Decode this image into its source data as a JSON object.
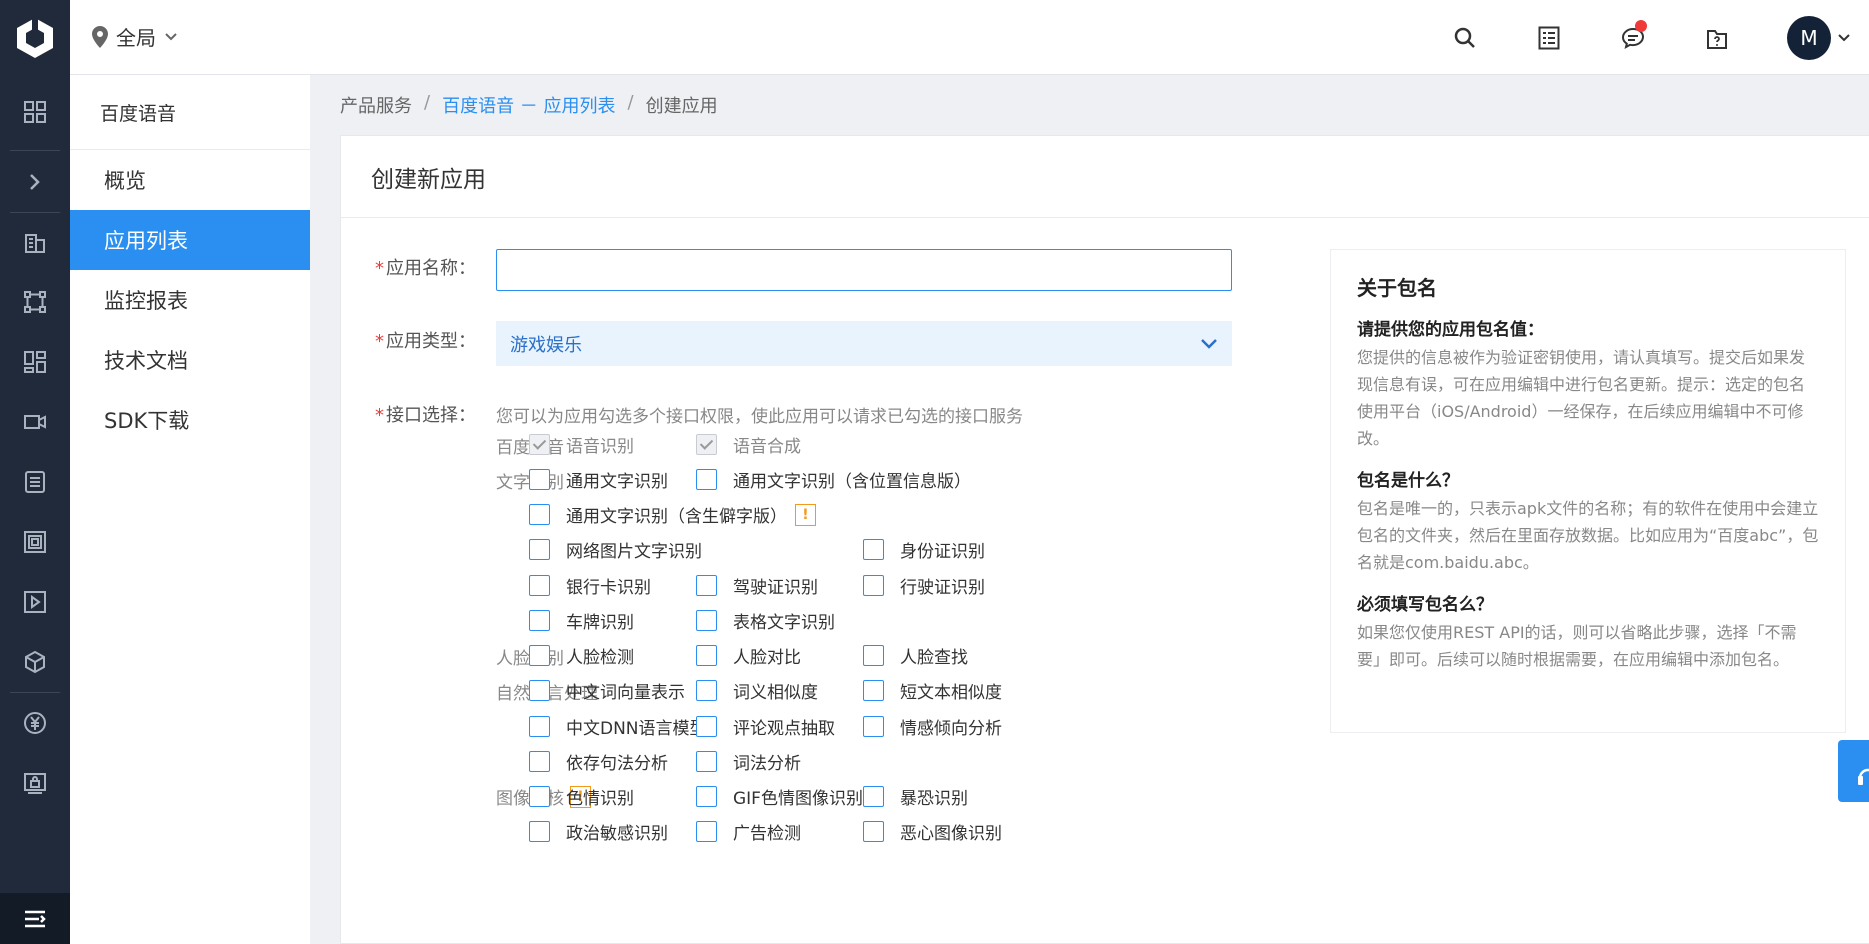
{
  "topbar": {
    "region": "全局",
    "avatar_letter": "M",
    "icons": [
      "search-icon",
      "list-icon",
      "message-icon",
      "help-icon"
    ]
  },
  "rail": {
    "icons": [
      "apps-icon",
      "chevron-right-icon",
      "building-icon",
      "network-icon",
      "dashboard-icon",
      "video-icon",
      "database-icon",
      "layers-icon",
      "play-icon",
      "cube-icon",
      "yuan-icon",
      "lock-icon",
      "menu-icon"
    ]
  },
  "subnav": {
    "title": "百度语音",
    "items": [
      {
        "label": "概览"
      },
      {
        "label": "应用列表"
      },
      {
        "label": "监控报表"
      },
      {
        "label": "技术文档"
      },
      {
        "label": "SDK下载"
      }
    ]
  },
  "breadcrumb": {
    "root": "产品服务",
    "sep1": "/",
    "link": "百度语音 － 应用列表",
    "sep2": "/",
    "current": "创建应用"
  },
  "form": {
    "title": "创建新应用",
    "required_mark": "*",
    "name_label": "应用名称：",
    "name_value": "",
    "type_label": "应用类型：",
    "type_value": "游戏娱乐",
    "api_label": "接口选择：",
    "api_hint": "您可以为应用勾选多个接口权限，使此应用可以请求已勾选的接口服务",
    "warn_mark": "!",
    "categories": {
      "voice": "百度语音",
      "ocr": "文字识别",
      "face": "人脸识别",
      "nlp": "自然语言处理",
      "image": "图像审核"
    },
    "checkboxes": {
      "asr": "语音识别",
      "tts": "语音合成",
      "ocr_general": "通用文字识别",
      "ocr_general_loc": "通用文字识别（含位置信息版）",
      "ocr_general_rare": "通用文字识别（含生僻字版）",
      "ocr_web": "网络图片文字识别",
      "ocr_idcard": "身份证识别",
      "ocr_bankcard": "银行卡识别",
      "ocr_driver": "驾驶证识别",
      "ocr_vehicle": "行驶证识别",
      "ocr_plate": "车牌识别",
      "ocr_table": "表格文字识别",
      "face_detect": "人脸检测",
      "face_match": "人脸对比",
      "face_search": "人脸查找",
      "nlp_wordvec": "中文词向量表示",
      "nlp_wordsim": "词义相似度",
      "nlp_textsim": "短文本相似度",
      "nlp_dnnlm": "中文DNN语言模型",
      "nlp_comment": "评论观点抽取",
      "nlp_sentiment": "情感倾向分析",
      "nlp_depparser": "依存句法分析",
      "nlp_lexer": "词法分析",
      "img_porn": "色情识别",
      "img_gif": "GIF色情图像识别",
      "img_terror": "暴恐识别",
      "img_politics": "政治敏感识别",
      "img_ad": "广告检测",
      "img_disgust": "恶心图像识别"
    }
  },
  "info": {
    "title": "关于包名",
    "q1": "请提供您的应用包名值：",
    "a1": "您提供的信息被作为验证密钥使用，请认真填写。提交后如果发现信息有误，可在应用编辑中进行包名更新。提示：选定的包名使用平台（iOS/Android）一经保存，在后续应用编辑中不可修改。",
    "q2": "包名是什么？",
    "a2": "包名是唯一的，只表示apk文件的名称；有的软件在使用中会建立包名的文件夹，然后在里面存放数据。比如应用为“百度abc”，包名就是com.baidu.abc。",
    "q3": "必须填写包名么？",
    "a3": "如果您仅使用REST API的话，则可以省略此步骤，选择「不需要」即可。后续可以随时根据需要，在应用编辑中添加包名。"
  },
  "colors": {
    "accent": "#2a8ff0",
    "rail": "#202a3a",
    "required": "#f03a3a",
    "warning": "#f39a1b"
  }
}
